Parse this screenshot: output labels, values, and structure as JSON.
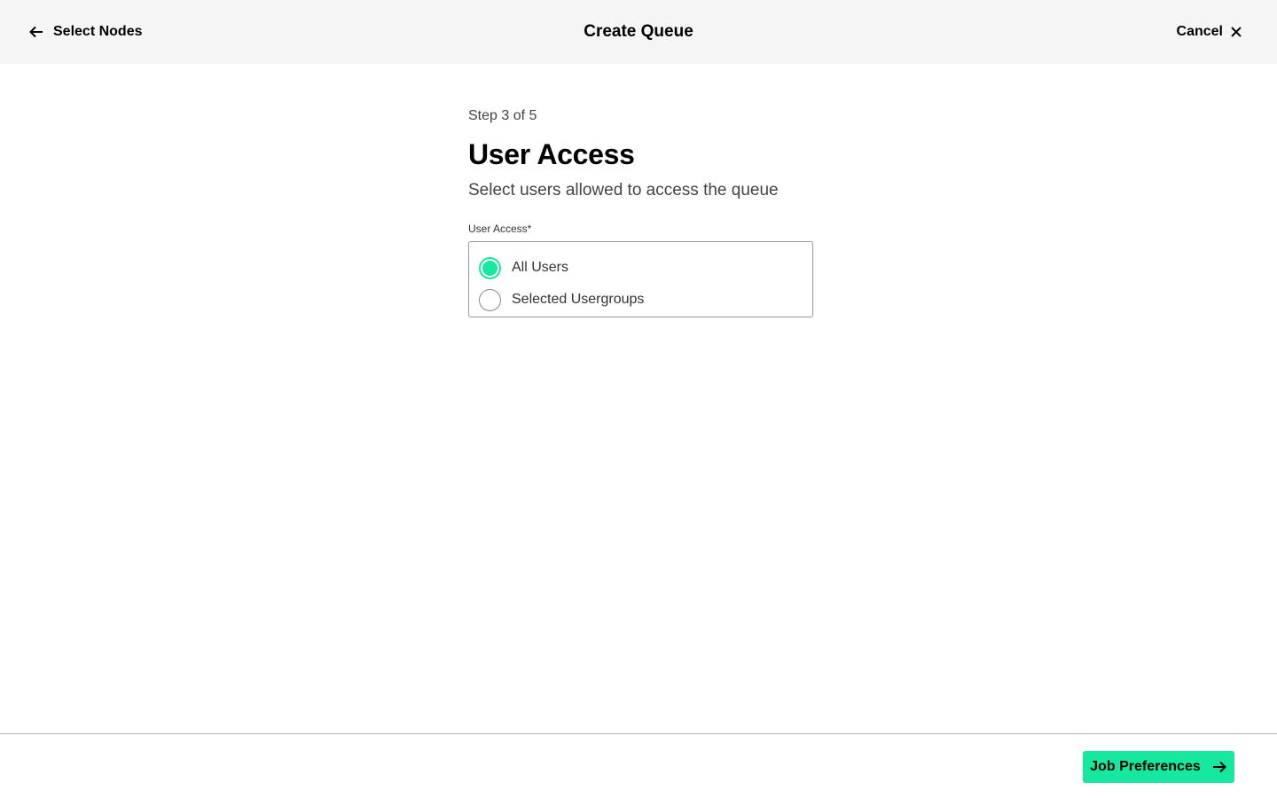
{
  "header": {
    "back_label": "Select Nodes",
    "title": "Create Queue",
    "cancel_label": "Cancel"
  },
  "step": {
    "indicator": "Step 3 of 5",
    "title": "User Access",
    "subtitle": "Select users allowed to access the queue"
  },
  "user_access": {
    "label": "User Access*",
    "options": [
      {
        "label": "All Users",
        "selected": true
      },
      {
        "label": "Selected Usergroups",
        "selected": false
      }
    ]
  },
  "footer": {
    "next_label": "Job Preferences"
  },
  "colors": {
    "accent": "#17e8a0",
    "header_bg": "#f5f5f5"
  },
  "icons": {
    "back": "arrow-left-icon",
    "cancel": "close-icon",
    "next": "arrow-right-icon"
  }
}
